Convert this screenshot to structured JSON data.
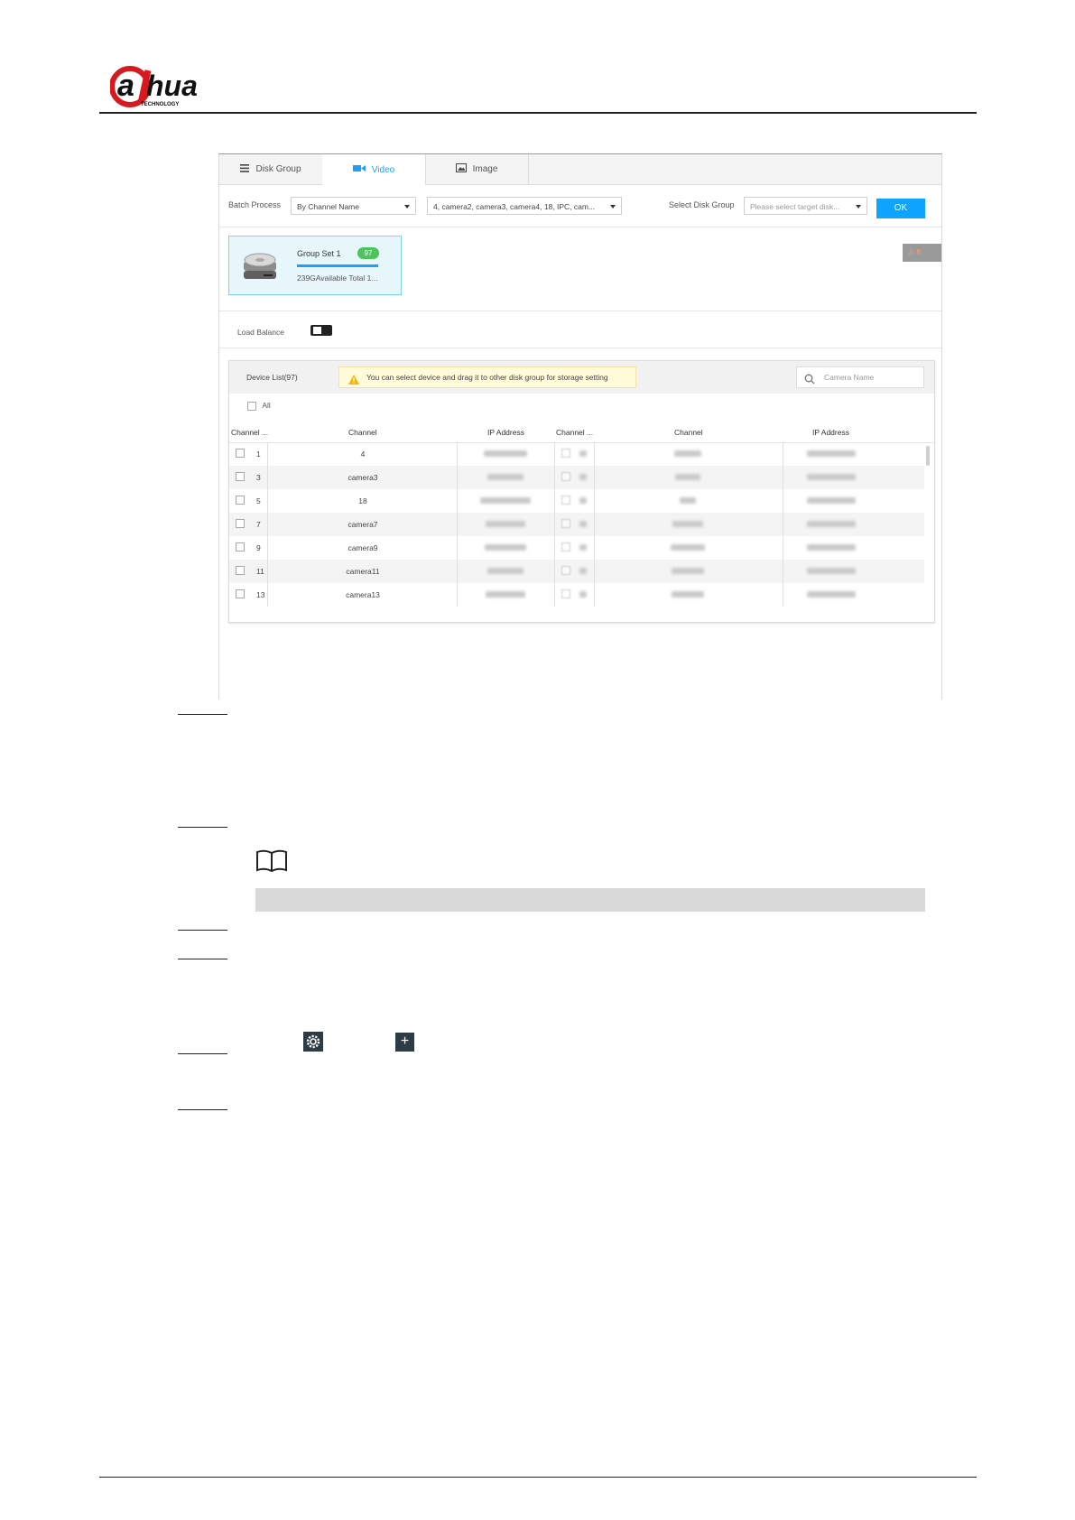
{
  "brand": {
    "logo_text": "alhua",
    "logo_sub": "TECHNOLOGY"
  },
  "tabs": [
    {
      "label": "Disk Group",
      "icon": "menu-icon"
    },
    {
      "label": "Video",
      "icon": "video-camera-icon",
      "active": true
    },
    {
      "label": "Image",
      "icon": "image-icon"
    }
  ],
  "toolbar": {
    "batch_label": "Batch Process",
    "batch_value": "By Channel Name",
    "channels_value": "4, camera2, camera3, camera4, 18, IPC, cam...",
    "disk_group_label": "Select Disk Group",
    "disk_group_placeholder": "Please select target disk...",
    "ok_label": "OK"
  },
  "group_card": {
    "name": "Group Set 1",
    "count": "97",
    "subtitle": "239GAvailable Total 1..."
  },
  "alert_chip": "⚠ 8",
  "load_balance": {
    "label": "Load Balance",
    "enabled": false
  },
  "device_list": {
    "title": "Device List(97)",
    "tip": "You can select device and drag it to other disk group for storage setting",
    "search_placeholder": "Camera Name",
    "all_label": "All",
    "headers": [
      "Channel ...",
      "Channel",
      "IP Address",
      "Channel ...",
      "Channel",
      "IP Address"
    ],
    "rows": [
      {
        "num": "1",
        "channel": "4"
      },
      {
        "num": "3",
        "channel": "camera3"
      },
      {
        "num": "5",
        "channel": "18"
      },
      {
        "num": "7",
        "channel": "camera7"
      },
      {
        "num": "9",
        "channel": "camera9"
      },
      {
        "num": "11",
        "channel": "camera11"
      },
      {
        "num": "13",
        "channel": "camera13"
      }
    ]
  },
  "colors": {
    "accent": "#1e9fff",
    "ok_button": "#0ea5ff",
    "badge": "#4cc35c",
    "card_bg": "#e6f6fb"
  },
  "doc_icons": [
    "book-icon",
    "gear-icon",
    "plus-icon"
  ]
}
